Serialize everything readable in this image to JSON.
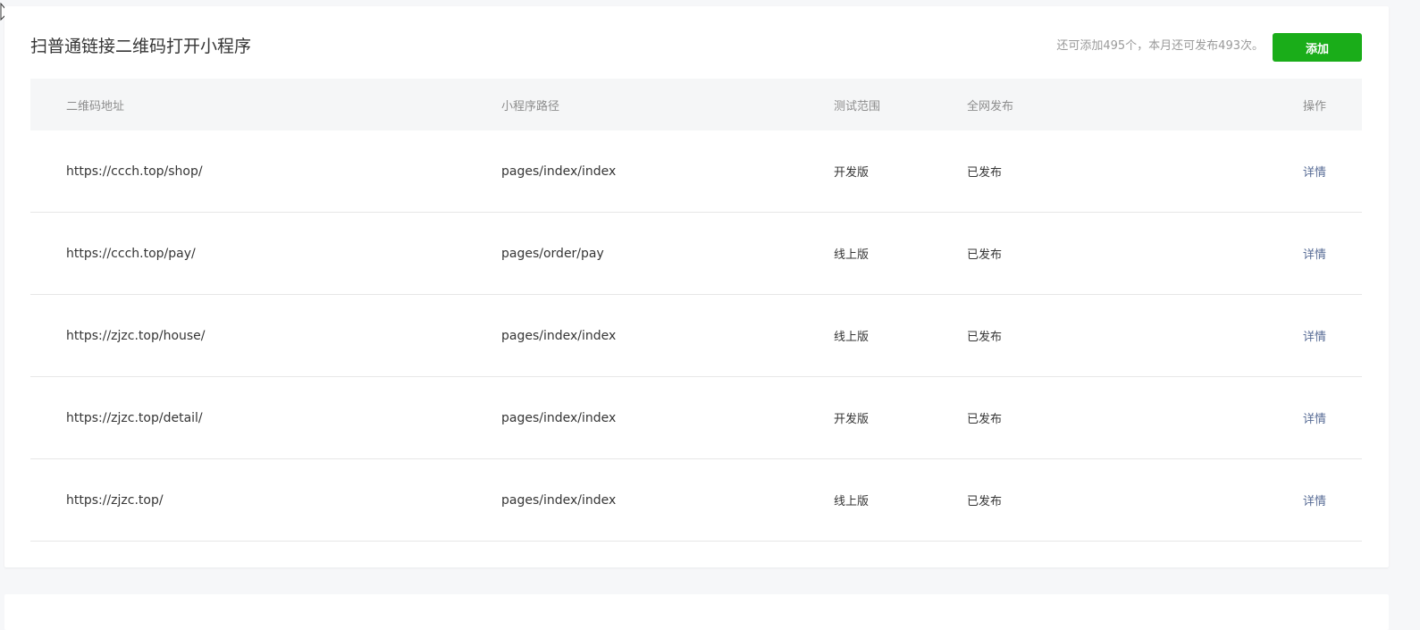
{
  "section": {
    "title": "扫普通链接二维码打开小程序",
    "quota_text": "还可添加495个，本月还可发布493次。",
    "add_button_label": "添加"
  },
  "table": {
    "headers": {
      "qr_url": "二维码地址",
      "path": "小程序路径",
      "test_scope": "测试范围",
      "publish": "全网发布",
      "action": "操作"
    },
    "rows": [
      {
        "qr_url": "https://ccch.top/shop/",
        "path": "pages/index/index",
        "test_scope": "开发版",
        "publish": "已发布",
        "action": "详情"
      },
      {
        "qr_url": "https://ccch.top/pay/",
        "path": "pages/order/pay",
        "test_scope": "线上版",
        "publish": "已发布",
        "action": "详情"
      },
      {
        "qr_url": "https://zjzc.top/house/",
        "path": "pages/index/index",
        "test_scope": "线上版",
        "publish": "已发布",
        "action": "详情"
      },
      {
        "qr_url": "https://zjzc.top/detail/",
        "path": "pages/index/index",
        "test_scope": "开发版",
        "publish": "已发布",
        "action": "详情"
      },
      {
        "qr_url": "https://zjzc.top/",
        "path": "pages/index/index",
        "test_scope": "线上版",
        "publish": "已发布",
        "action": "详情"
      }
    ]
  },
  "colors": {
    "accent_green": "#1aad19",
    "link_blue": "#576b95",
    "header_bg": "#f5f6f7"
  }
}
